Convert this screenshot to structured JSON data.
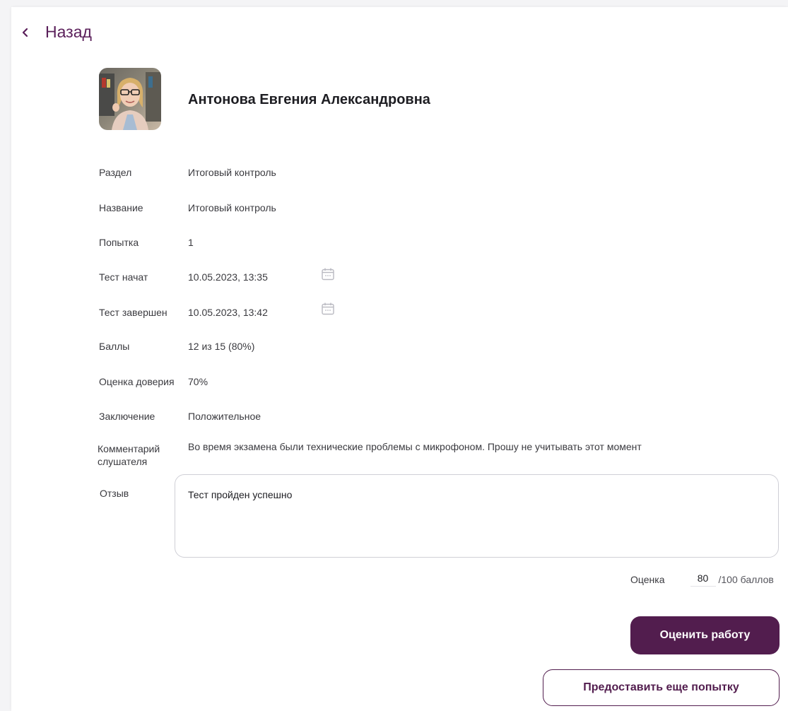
{
  "nav": {
    "back_label": "Назад"
  },
  "profile": {
    "name": "Антонова Евгения Александровна"
  },
  "details": [
    {
      "label": "Раздел",
      "value": "Итоговый контроль"
    },
    {
      "label": "Название",
      "value": "Итоговый контроль"
    },
    {
      "label": "Попытка",
      "value": "1"
    },
    {
      "label": "Тест начат",
      "value": "10.05.2023, 13:35"
    },
    {
      "label": "Тест завершен",
      "value": "10.05.2023, 13:42"
    },
    {
      "label": "Баллы",
      "value": "12 из 15 (80%)"
    },
    {
      "label": "Оценка доверия",
      "value": "70%"
    },
    {
      "label": "Заключение",
      "value": "Положительное"
    }
  ],
  "comment": {
    "label": "Комментарий слушателя",
    "value": "Во время экзамена были технические проблемы с микрофоном. Прошу не учитывать этот момент"
  },
  "review": {
    "label": "Отзыв",
    "value": "Тест пройден успешно"
  },
  "grade": {
    "label": "Оценка",
    "value": "80",
    "suffix": "/100 баллов"
  },
  "actions": {
    "grade_button": "Оценить работу",
    "retry_button": "Предоставить еще попытку"
  },
  "colors": {
    "accent": "#521d4e",
    "text": "#3a3a3f"
  },
  "icons": {
    "back": "chevron-left-icon",
    "date": "calendar-icon"
  }
}
